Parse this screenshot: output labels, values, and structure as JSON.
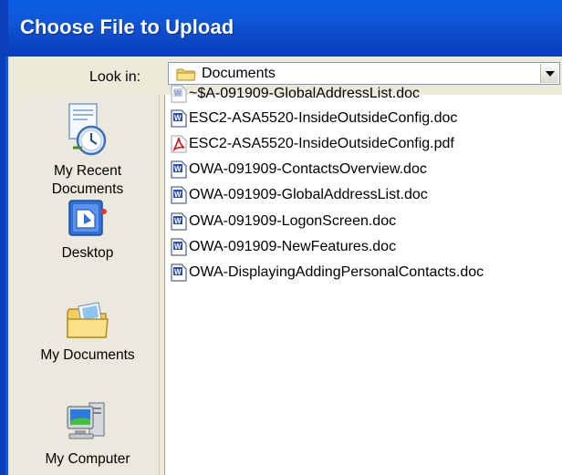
{
  "window": {
    "title": "Choose File to Upload"
  },
  "lookin": {
    "label": "Look in:",
    "value": "Documents",
    "icon": "folder-icon"
  },
  "places": [
    {
      "label_lines": [
        "My Recent",
        "Documents"
      ],
      "icon": "recent-documents-icon"
    },
    {
      "label_lines": [
        "Desktop"
      ],
      "icon": "desktop-icon"
    },
    {
      "label_lines": [
        "My Documents"
      ],
      "icon": "my-documents-icon"
    },
    {
      "label_lines": [
        "My Computer"
      ],
      "icon": "my-computer-icon"
    }
  ],
  "files": [
    {
      "name": "~$A-091909-GlobalAddressList.doc",
      "type": "word-temp"
    },
    {
      "name": "ESC2-ASA5520-InsideOutsideConfig.doc",
      "type": "word"
    },
    {
      "name": "ESC2-ASA5520-InsideOutsideConfig.pdf",
      "type": "pdf"
    },
    {
      "name": "OWA-091909-ContactsOverview.doc",
      "type": "word"
    },
    {
      "name": "OWA-091909-GlobalAddressList.doc",
      "type": "word"
    },
    {
      "name": "OWA-091909-LogonScreen.doc",
      "type": "word"
    },
    {
      "name": "OWA-091909-NewFeatures.doc",
      "type": "word"
    },
    {
      "name": "OWA-DisplayingAddingPersonalContacts.doc",
      "type": "word"
    }
  ],
  "colors": {
    "titlebar": "#0a50d2",
    "dialog": "#ece9d8",
    "list": "#ffffff"
  }
}
